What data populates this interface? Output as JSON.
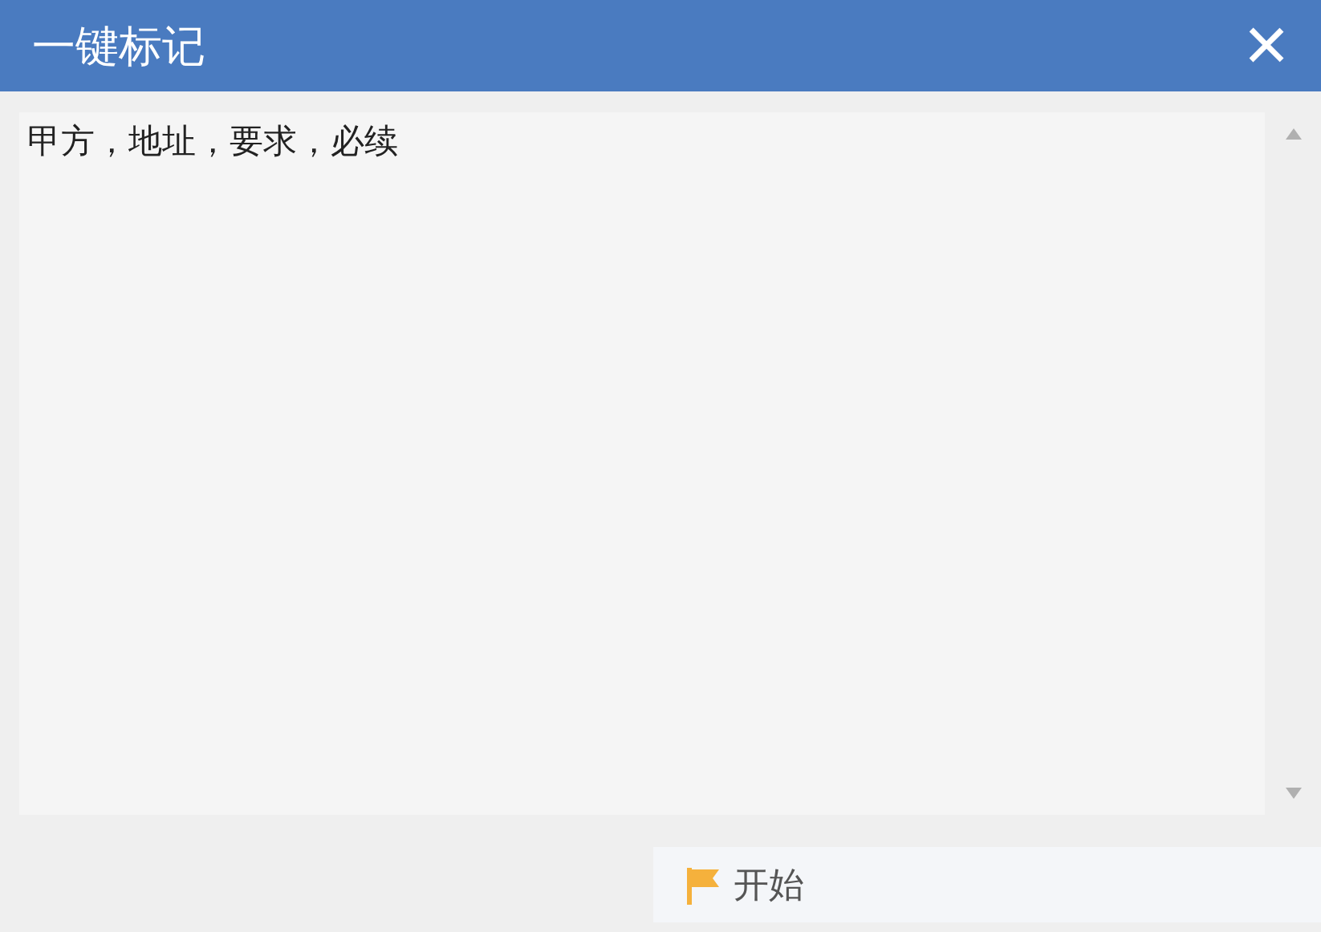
{
  "window": {
    "title": "一键标记",
    "close": "×"
  },
  "textarea": {
    "value": "甲方，地址，要求，必续"
  },
  "button": {
    "label": "开始"
  }
}
